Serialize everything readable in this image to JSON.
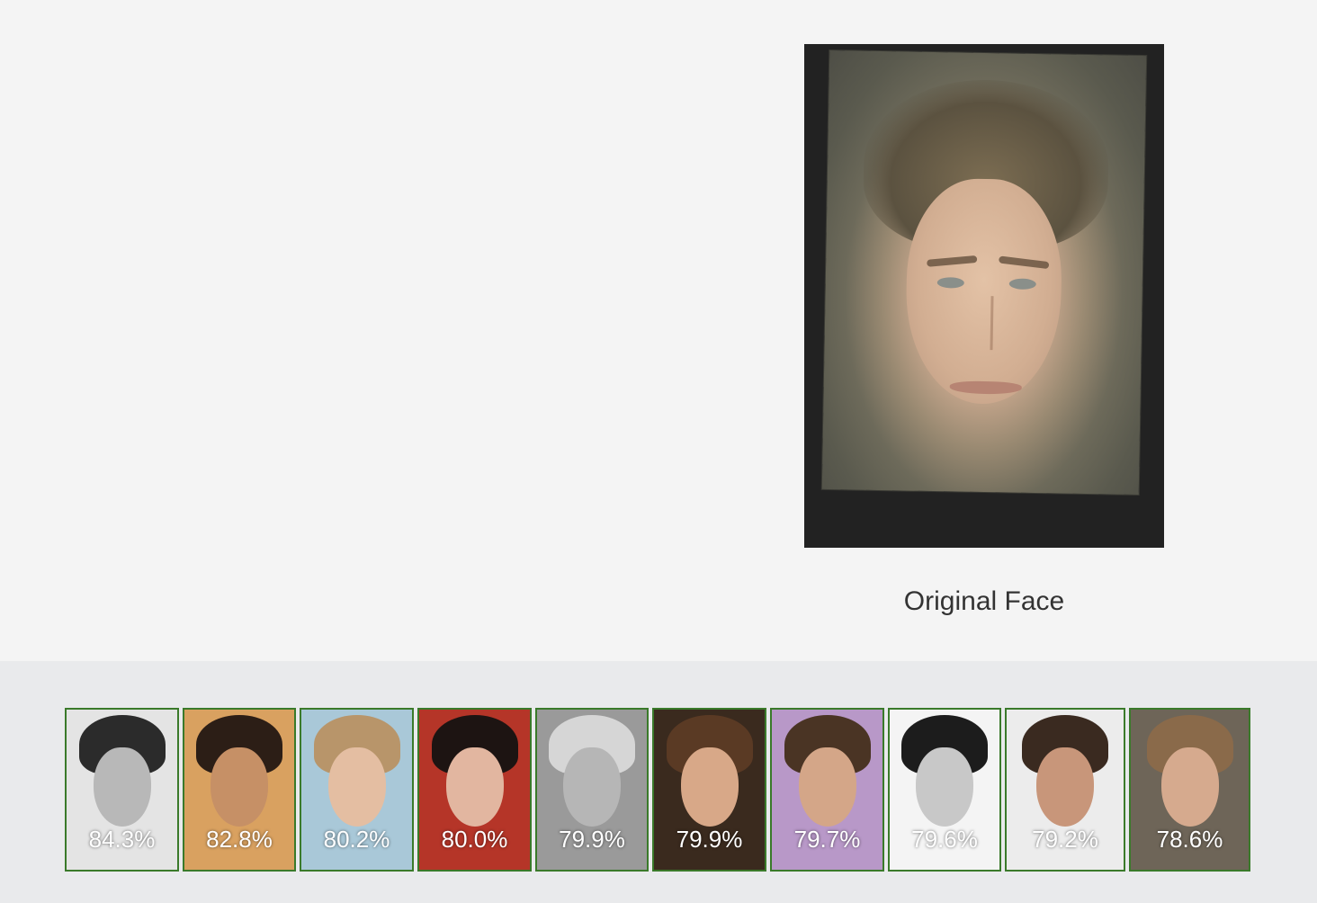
{
  "original": {
    "caption": "Original Face"
  },
  "matches": [
    {
      "score": "84.3%",
      "bg": "#e4e4e4",
      "hair": "#2b2b2b",
      "skin": "#b8b8b8"
    },
    {
      "score": "82.8%",
      "bg": "#d9a160",
      "hair": "#2c1e16",
      "skin": "#c69066"
    },
    {
      "score": "80.2%",
      "bg": "#a9c8d8",
      "hair": "#b8956a",
      "skin": "#e4bea2"
    },
    {
      "score": "80.0%",
      "bg": "#b53528",
      "hair": "#1d1412",
      "skin": "#e2b6a0"
    },
    {
      "score": "79.9%",
      "bg": "#9a9a9a",
      "hair": "#d6d6d6",
      "skin": "#b6b6b6"
    },
    {
      "score": "79.9%",
      "bg": "#3a2a1e",
      "hair": "#5a3a24",
      "skin": "#d8a888"
    },
    {
      "score": "79.7%",
      "bg": "#b898c8",
      "hair": "#4a3424",
      "skin": "#d4a688"
    },
    {
      "score": "79.6%",
      "bg": "#f4f4f4",
      "hair": "#1c1c1c",
      "skin": "#c8c8c8"
    },
    {
      "score": "79.2%",
      "bg": "#ececec",
      "hair": "#3a2a20",
      "skin": "#c8967a"
    },
    {
      "score": "78.6%",
      "bg": "#6e6558",
      "hair": "#8a6a4a",
      "skin": "#d6aa8e"
    }
  ]
}
